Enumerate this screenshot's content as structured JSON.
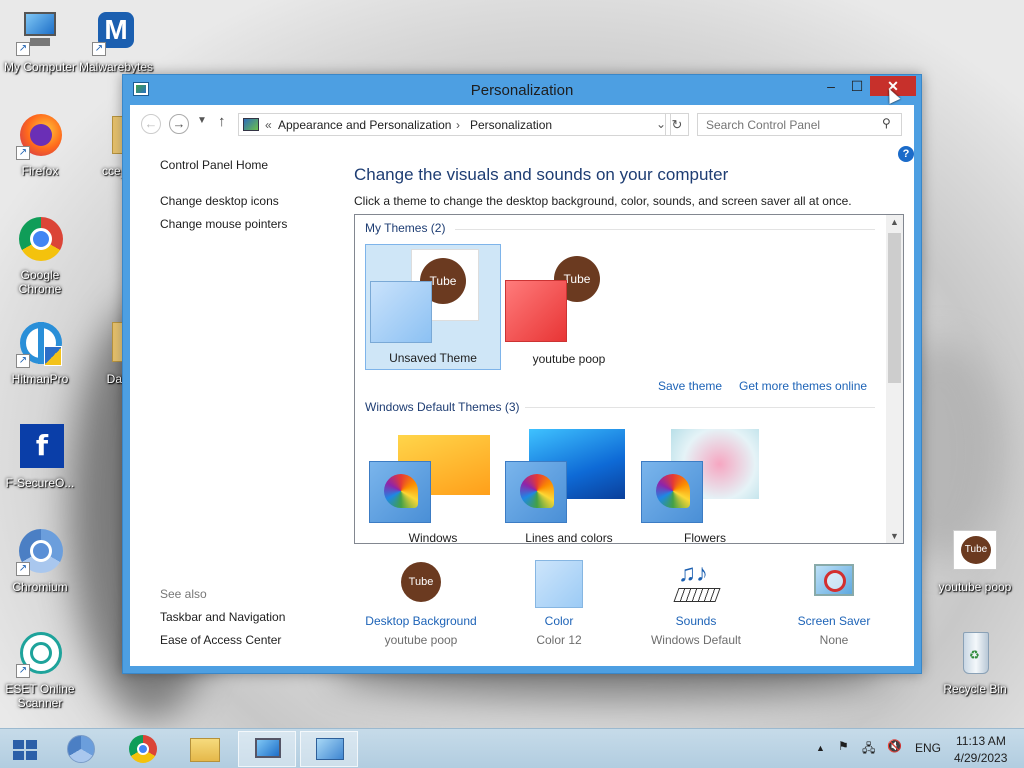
{
  "desktop": {
    "icons": [
      {
        "label": "My Computer"
      },
      {
        "label": "Malwarebytes"
      },
      {
        "label": "Firefox"
      },
      {
        "label": "cce_j"
      },
      {
        "label": "Google Chrome"
      },
      {
        "label": "HitmanPro"
      },
      {
        "label": "Dat"
      },
      {
        "label": "F-SecureO..."
      },
      {
        "label": "Chromium"
      },
      {
        "label": "ESET Online Scanner"
      },
      {
        "label": "youtube poop"
      },
      {
        "label": "Recycle Bin"
      }
    ]
  },
  "window": {
    "title": "Personalization",
    "minimize": "–",
    "maximize": "☐",
    "close": "✕"
  },
  "address": {
    "chevron": "«",
    "crumbs": [
      "Appearance and Personalization",
      "Personalization"
    ],
    "separator": "›",
    "search_placeholder": "Search Control Panel"
  },
  "left_pane": {
    "home": "Control Panel Home",
    "links": [
      "Change desktop icons",
      "Change mouse pointers"
    ],
    "see_also_label": "See also",
    "see_also": [
      "Taskbar and Navigation",
      "Ease of Access Center"
    ]
  },
  "main": {
    "headline": "Change the visuals and sounds on your computer",
    "subline": "Click a theme to change the desktop background, color, sounds, and screen saver all at once.",
    "my_themes_title": "My Themes (2)",
    "my_themes": [
      "Unsaved Theme",
      "youtube poop"
    ],
    "save_theme": "Save theme",
    "get_more": "Get more themes online",
    "default_title": "Windows Default Themes (3)",
    "default_themes": [
      "Windows",
      "Lines and colors",
      "Flowers"
    ]
  },
  "bottom": {
    "items": [
      {
        "label": "Desktop Background",
        "value": "youtube poop"
      },
      {
        "label": "Color",
        "value": "Color 12"
      },
      {
        "label": "Sounds",
        "value": "Windows Default"
      },
      {
        "label": "Screen Saver",
        "value": "None"
      }
    ]
  },
  "taskbar": {
    "language": "ENG",
    "time": "11:13 AM",
    "date": "4/29/2023"
  },
  "colors": {
    "window_frame": "#4d9fe2",
    "link": "#1d63b7",
    "close": "#c7302b"
  }
}
